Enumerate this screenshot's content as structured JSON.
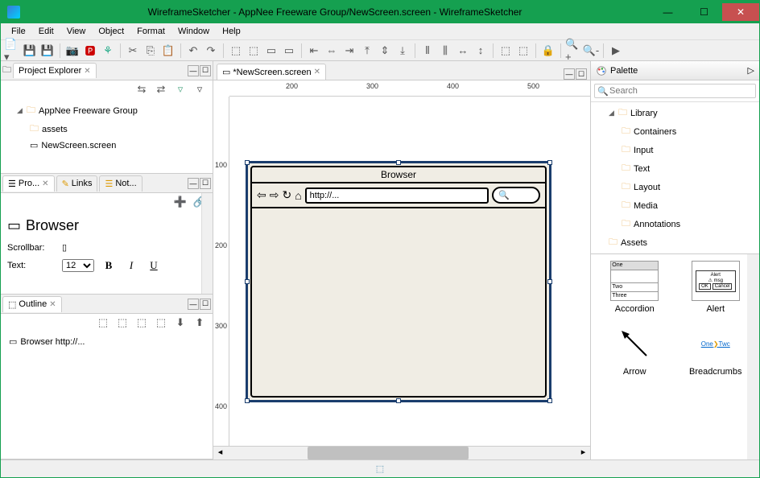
{
  "window": {
    "title": "WireframeSketcher - AppNee Freeware Group/NewScreen.screen - WireframeSketcher"
  },
  "menubar": [
    "File",
    "Edit",
    "View",
    "Object",
    "Format",
    "Window",
    "Help"
  ],
  "project_explorer": {
    "tab": "Project Explorer",
    "root": "AppNee Freeware Group",
    "items": [
      "assets",
      "NewScreen.screen"
    ]
  },
  "properties": {
    "tabs": [
      "Pro...",
      "Links",
      "Not..."
    ],
    "title": "Browser",
    "scrollbar_label": "Scrollbar:",
    "text_label": "Text:",
    "font_size": "12"
  },
  "outline": {
    "tab": "Outline",
    "item": "Browser http://..."
  },
  "editor": {
    "tab": "*NewScreen.screen",
    "ruler_h": [
      "200",
      "300",
      "400",
      "500"
    ],
    "ruler_v": [
      "100",
      "200",
      "300",
      "400"
    ],
    "browser": {
      "title": "Browser",
      "url": "http://..."
    }
  },
  "palette": {
    "title": "Palette",
    "search_placeholder": "Search",
    "library": "Library",
    "categories": [
      "Containers",
      "Input",
      "Text",
      "Layout",
      "Media",
      "Annotations"
    ],
    "assets": "Assets",
    "items": [
      "Accordion",
      "Alert",
      "Arrow",
      "Breadcrumbs"
    ],
    "breadcrumb_sample": [
      "One",
      "Twc"
    ]
  }
}
